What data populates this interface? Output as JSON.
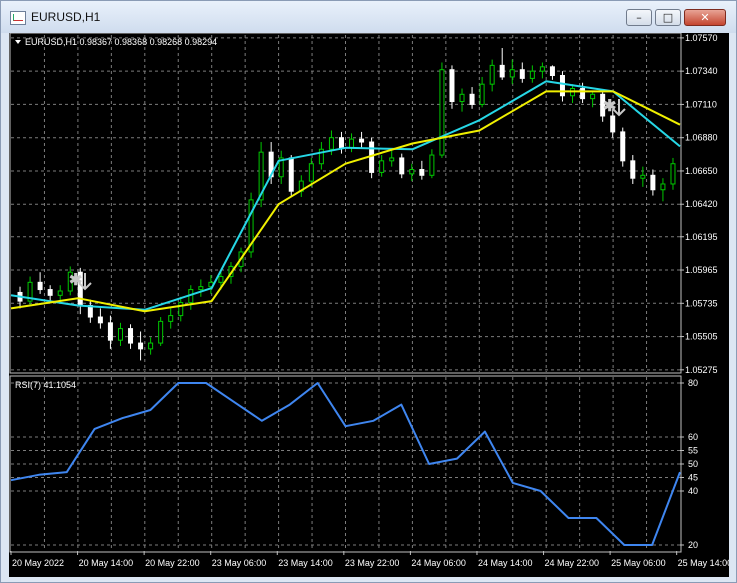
{
  "window": {
    "title": "EURUSD,H1",
    "minimize": "–",
    "maximize": "□",
    "close": "✕"
  },
  "main_pane": {
    "header": "EURUSD,H1  0.98367 0.98368 0.98268 0.98294",
    "ylim": [
      1.0526,
      1.0759
    ],
    "price_ticks": [
      "1.07570",
      "1.07340",
      "1.07110",
      "1.06880",
      "1.06650",
      "1.06420",
      "1.06195",
      "1.05965",
      "1.05735",
      "1.05505",
      "1.05275"
    ],
    "colors": {
      "bull": "#00c800",
      "bear": "#ffffff",
      "fast_ma": "#26d7e6",
      "slow_ma": "#f0f000",
      "grid": "#7c7c7c",
      "arrow": "#c8c8c8"
    }
  },
  "rsi_pane": {
    "header": "RSI(7) 41.1054",
    "ticks": [
      "80",
      "60",
      "55",
      "50",
      "45",
      "40",
      "20"
    ],
    "color": "#3f86f0"
  },
  "time_axis": [
    "20 May 2022",
    "20 May 14:00",
    "20 May 22:00",
    "23 May 06:00",
    "23 May 14:00",
    "23 May 22:00",
    "24 May 06:00",
    "24 May 14:00",
    "24 May 22:00",
    "25 May 06:00",
    "25 May 14:00"
  ],
  "chart_data": {
    "type": "line",
    "x": [
      "20 May 2022",
      "20 May 14:00",
      "20 May 22:00",
      "23 May 06:00",
      "23 May 14:00",
      "23 May 22:00",
      "24 May 06:00",
      "24 May 14:00",
      "24 May 22:00",
      "25 May 06:00",
      "25 May 14:00"
    ],
    "series": [
      {
        "values": [
          1.0576,
          1.056,
          1.0572,
          1.061,
          1.0688,
          1.0666,
          1.0678,
          1.0718,
          1.0728,
          1.07,
          1.0665
        ]
      },
      {
        "values": [
          1.0579,
          1.0572,
          1.0569,
          1.0584,
          1.0672,
          1.0681,
          1.068,
          1.07,
          1.0727,
          1.072,
          1.0682
        ]
      },
      {
        "values": [
          1.057,
          1.0577,
          1.0568,
          1.0575,
          1.0642,
          1.067,
          1.0684,
          1.0693,
          1.072,
          1.072,
          1.0697
        ]
      }
    ],
    "rsi": [
      44,
      46,
      47,
      63,
      67,
      70,
      80,
      80,
      73,
      66,
      72,
      80,
      64,
      66,
      72,
      50,
      52,
      62,
      43,
      40,
      30,
      30,
      20,
      20,
      47
    ],
    "rsi_ylim": [
      20,
      80
    ],
    "candles": [
      [
        1.0581,
        1.0585,
        1.057,
        1.0575
      ],
      [
        1.0575,
        1.0592,
        1.0572,
        1.0588
      ],
      [
        1.0588,
        1.0595,
        1.058,
        1.0583
      ],
      [
        1.0583,
        1.0586,
        1.0575,
        1.0579
      ],
      [
        1.0579,
        1.0586,
        1.0574,
        1.0582
      ],
      [
        1.0582,
        1.0599,
        1.0579,
        1.0595
      ],
      [
        1.0595,
        1.0598,
        1.0566,
        1.0572
      ],
      [
        1.0572,
        1.0576,
        1.056,
        1.0564
      ],
      [
        1.0564,
        1.057,
        1.0556,
        1.056
      ],
      [
        1.056,
        1.0565,
        1.0542,
        1.0548
      ],
      [
        1.0548,
        1.056,
        1.0544,
        1.0556
      ],
      [
        1.0556,
        1.0559,
        1.0542,
        1.0546
      ],
      [
        1.0546,
        1.0554,
        1.0534,
        1.0542
      ],
      [
        1.0542,
        1.055,
        1.0538,
        1.0546
      ],
      [
        1.0546,
        1.0564,
        1.0544,
        1.0561
      ],
      [
        1.0561,
        1.057,
        1.0556,
        1.0565
      ],
      [
        1.0565,
        1.0578,
        1.0561,
        1.0574
      ],
      [
        1.0574,
        1.0586,
        1.0569,
        1.0583
      ],
      [
        1.0583,
        1.059,
        1.0578,
        1.0585
      ],
      [
        1.0585,
        1.0593,
        1.058,
        1.0588
      ],
      [
        1.0588,
        1.0596,
        1.0583,
        1.0592
      ],
      [
        1.0592,
        1.0602,
        1.0587,
        1.0599
      ],
      [
        1.0599,
        1.0612,
        1.0595,
        1.0609
      ],
      [
        1.0609,
        1.065,
        1.0605,
        1.0645
      ],
      [
        1.0645,
        1.0685,
        1.064,
        1.0678
      ],
      [
        1.0678,
        1.0685,
        1.0656,
        1.0661
      ],
      [
        1.0661,
        1.0679,
        1.0656,
        1.0674
      ],
      [
        1.0674,
        1.0676,
        1.0648,
        1.0651
      ],
      [
        1.0651,
        1.0662,
        1.0647,
        1.0658
      ],
      [
        1.0658,
        1.0674,
        1.0654,
        1.067
      ],
      [
        1.067,
        1.0685,
        1.0666,
        1.068
      ],
      [
        1.068,
        1.0693,
        1.0676,
        1.0688
      ],
      [
        1.0688,
        1.0692,
        1.0677,
        1.0681
      ],
      [
        1.0681,
        1.0691,
        1.0678,
        1.0687
      ],
      [
        1.0687,
        1.0692,
        1.0681,
        1.0685
      ],
      [
        1.0685,
        1.0688,
        1.066,
        1.0664
      ],
      [
        1.0664,
        1.0676,
        1.0661,
        1.0672
      ],
      [
        1.0672,
        1.0679,
        1.0668,
        1.0674
      ],
      [
        1.0674,
        1.0677,
        1.066,
        1.0663
      ],
      [
        1.0663,
        1.067,
        1.0658,
        1.0666
      ],
      [
        1.0666,
        1.0672,
        1.0659,
        1.0662
      ],
      [
        1.0662,
        1.068,
        1.066,
        1.0676
      ],
      [
        1.0676,
        1.074,
        1.0674,
        1.0735
      ],
      [
        1.0735,
        1.0738,
        1.0708,
        1.0713
      ],
      [
        1.0713,
        1.0722,
        1.0706,
        1.0718
      ],
      [
        1.0718,
        1.0723,
        1.0708,
        1.0711
      ],
      [
        1.0711,
        1.073,
        1.0709,
        1.0725
      ],
      [
        1.0725,
        1.0742,
        1.072,
        1.0738
      ],
      [
        1.0738,
        1.075,
        1.0728,
        1.073
      ],
      [
        1.073,
        1.0742,
        1.0725,
        1.0735
      ],
      [
        1.0735,
        1.074,
        1.0726,
        1.0729
      ],
      [
        1.0729,
        1.0738,
        1.0726,
        1.0734
      ],
      [
        1.0734,
        1.074,
        1.0729,
        1.0737
      ],
      [
        1.0737,
        1.0738,
        1.0728,
        1.0731
      ],
      [
        1.0731,
        1.0734,
        1.0713,
        1.0717
      ],
      [
        1.0717,
        1.0725,
        1.0712,
        1.0722
      ],
      [
        1.0722,
        1.0726,
        1.0712,
        1.0715
      ],
      [
        1.0715,
        1.072,
        1.0709,
        1.0718
      ],
      [
        1.0718,
        1.0721,
        1.0699,
        1.0703
      ],
      [
        1.0703,
        1.0708,
        1.0688,
        1.0692
      ],
      [
        1.0692,
        1.0695,
        1.0668,
        1.0672
      ],
      [
        1.0672,
        1.0676,
        1.0656,
        1.066
      ],
      [
        1.066,
        1.0668,
        1.0654,
        1.0662
      ],
      [
        1.0662,
        1.0666,
        1.0648,
        1.0652
      ],
      [
        1.0652,
        1.066,
        1.0644,
        1.0656
      ],
      [
        1.0656,
        1.0674,
        1.0652,
        1.067
      ]
    ]
  }
}
